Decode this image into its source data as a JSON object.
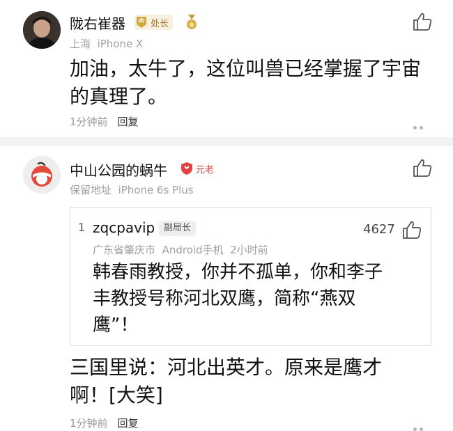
{
  "comment1": {
    "username": "陇右崔器",
    "badge": "处长",
    "location": "上海",
    "device": "iPhone X",
    "text": "加油，太牛了，这位叫兽已经掌握了宇宙的真理了。",
    "time": "1分钟前",
    "reply_label": "回复",
    "icons": {
      "avatar": "user-avatar-photo",
      "badge": "rank-badge-icon",
      "medal": "medal-icon",
      "like": "thumbs-up-icon",
      "more": "more-dots-icon"
    }
  },
  "comment2": {
    "username": "中山公园的蜗牛",
    "badge": "元老",
    "location": "保留地址",
    "device": "iPhone 6s Plus",
    "quoted": {
      "floor": "1",
      "username": "zqcpavip",
      "badge": "副局长",
      "likes": "4627",
      "location": "广东省肇庆市",
      "device": "Android手机",
      "time": "2小时前",
      "text_line1": "韩春雨教授，你并不孤单，你和李子",
      "text_line2": "丰教授号称河北双鹰，简称“燕双",
      "text_line3": "鹰”！"
    },
    "text_line1": "三国里说：河北出英才。原来是鹰才",
    "text_line2": "啊！[大笑]",
    "time": "1分钟前",
    "reply_label": "回复",
    "icons": {
      "avatar": "user-avatar-logo",
      "badge": "shield-badge-icon",
      "like": "thumbs-up-icon",
      "more": "more-dots-icon"
    }
  },
  "colors": {
    "gold": "#d4a53a",
    "red": "#e34340",
    "meta_gray": "#a0a0a0",
    "divider": "#f3f3f3"
  }
}
